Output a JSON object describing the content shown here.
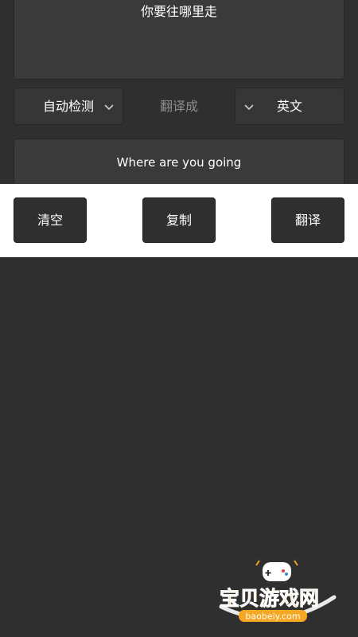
{
  "source": {
    "text": "你要往哪里走"
  },
  "languages": {
    "source_lang": "自动检测",
    "translate_to_label": "翻译成",
    "target_lang": "英文"
  },
  "result": {
    "text": "Where are you going"
  },
  "actions": {
    "clear_label": "清空",
    "copy_label": "复制",
    "translate_label": "翻译"
  },
  "watermark": {
    "brand": "宝贝游戏网",
    "domain": "baobeiy.com"
  },
  "colors": {
    "background": "#2f2f2f",
    "panel": "#3a3a3a",
    "action_bar": "#ffffff",
    "muted_text": "#8e8e8e",
    "watermark_orange": "#f5a623"
  },
  "icons": {
    "dropdown": "chevron-down-icon"
  }
}
